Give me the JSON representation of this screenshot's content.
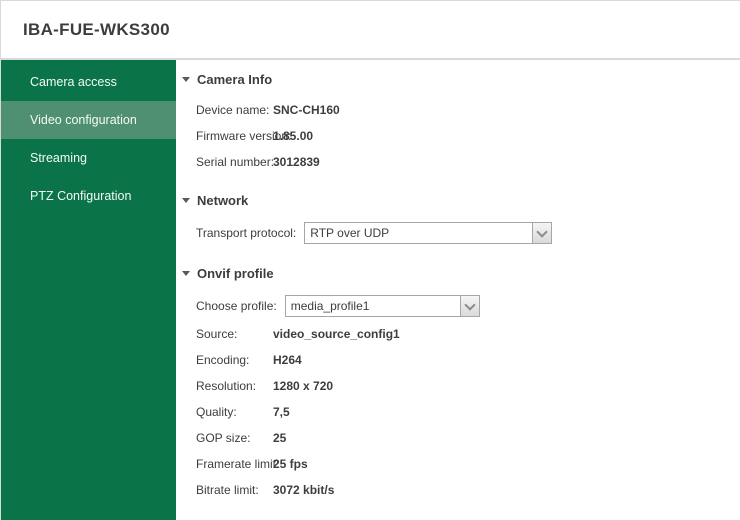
{
  "window": {
    "title": "IBA-FUE-WKS300"
  },
  "colors": {
    "sidebar_green": "#0a7448",
    "sidebar_selected_green": "#4e9070",
    "border_gray": "#d9d9d9",
    "text_dark": "#3d3d3d",
    "combo_border": "#a6a6a6"
  },
  "sidebar": {
    "items": [
      {
        "label": "Camera access",
        "selected": false
      },
      {
        "label": "Video configuration",
        "selected": true
      },
      {
        "label": "Streaming",
        "selected": false
      },
      {
        "label": "PTZ Configuration",
        "selected": false
      }
    ]
  },
  "sections": [
    {
      "title": "Camera Info",
      "rows": [
        {
          "label": "Device name:",
          "value": "SNC-CH160",
          "type": "text"
        },
        {
          "label": "Firmware version:",
          "value": "1.85.00",
          "type": "text"
        },
        {
          "label": "Serial number:",
          "value": "3012839",
          "type": "text"
        }
      ]
    },
    {
      "title": "Network",
      "rows": [
        {
          "label": "Transport protocol:",
          "value": "RTP over UDP",
          "type": "select"
        }
      ]
    },
    {
      "title": "Onvif profile",
      "rows": [
        {
          "label": "Choose profile:",
          "value": "media_profile1",
          "type": "select"
        },
        {
          "label": "Source:",
          "value": "video_source_config1",
          "type": "text"
        },
        {
          "label": "Encoding:",
          "value": "H264",
          "type": "text"
        },
        {
          "label": "Resolution:",
          "value": "1280 x 720",
          "type": "text"
        },
        {
          "label": "Quality:",
          "value": "7,5",
          "type": "text"
        },
        {
          "label": "GOP size:",
          "value": "25",
          "type": "text"
        },
        {
          "label": "Framerate limit:",
          "value": "25 fps",
          "type": "text"
        },
        {
          "label": "Bitrate limit:",
          "value": "3072 kbit/s",
          "type": "text"
        }
      ]
    }
  ]
}
